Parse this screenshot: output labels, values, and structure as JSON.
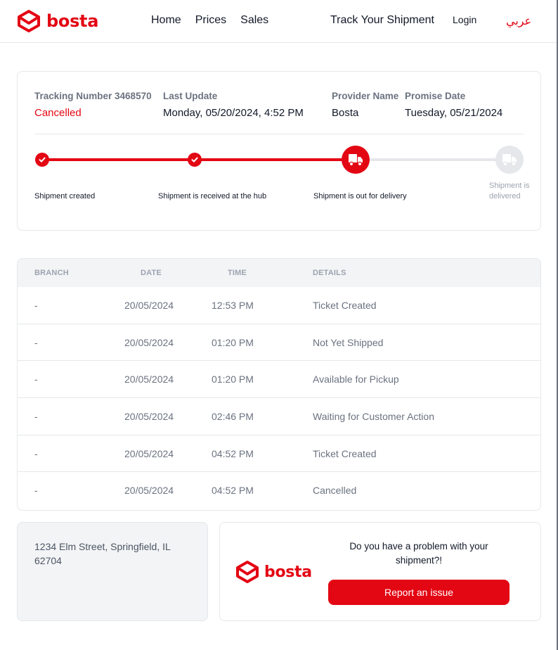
{
  "brand": {
    "name": "bosta",
    "color": "#e30613",
    "logo_icon": "envelope-box-icon"
  },
  "nav": {
    "home": "Home",
    "prices": "Prices",
    "sales": "Sales",
    "track": "Track Your Shipment",
    "login": "Login",
    "language": "عربي"
  },
  "shipment": {
    "tracking_label": "Tracking Number 3468570",
    "status": "Cancelled",
    "last_update_label": "Last Update",
    "last_update_value": "Monday, 05/20/2024, 4:52 PM",
    "provider_label": "Provider Name",
    "provider_value": "Bosta",
    "promise_label": "Promise Date",
    "promise_value": "Tuesday, 05/21/2024"
  },
  "progress": {
    "steps": [
      {
        "label": "Shipment created",
        "state": "done",
        "icon": "check-icon"
      },
      {
        "label": "Shipment is received at the hub",
        "state": "done",
        "icon": "check-icon"
      },
      {
        "label": "Shipment is out for delivery",
        "state": "active",
        "icon": "truck-icon"
      },
      {
        "label": "Shipment is delivered",
        "state": "pending",
        "icon": "truck-icon"
      }
    ]
  },
  "table": {
    "headers": [
      "BRANCH",
      "DATE",
      "TIME",
      "DETAILS"
    ],
    "rows": [
      [
        "-",
        "20/05/2024",
        "12:53 PM",
        "Ticket Created"
      ],
      [
        "-",
        "20/05/2024",
        "01:20 PM",
        "Not Yet Shipped"
      ],
      [
        "-",
        "20/05/2024",
        "01:20 PM",
        "Available for Pickup"
      ],
      [
        "-",
        "20/05/2024",
        "02:46 PM",
        "Waiting for Customer Action"
      ],
      [
        "-",
        "20/05/2024",
        "04:52 PM",
        "Ticket Created"
      ],
      [
        "-",
        "20/05/2024",
        "04:52 PM",
        "Cancelled"
      ]
    ]
  },
  "address": {
    "text": "1234 Elm Street, Springfield, IL 62704"
  },
  "issue": {
    "question": "Do you have a problem with your shipment?!",
    "button": "Report an issue"
  }
}
